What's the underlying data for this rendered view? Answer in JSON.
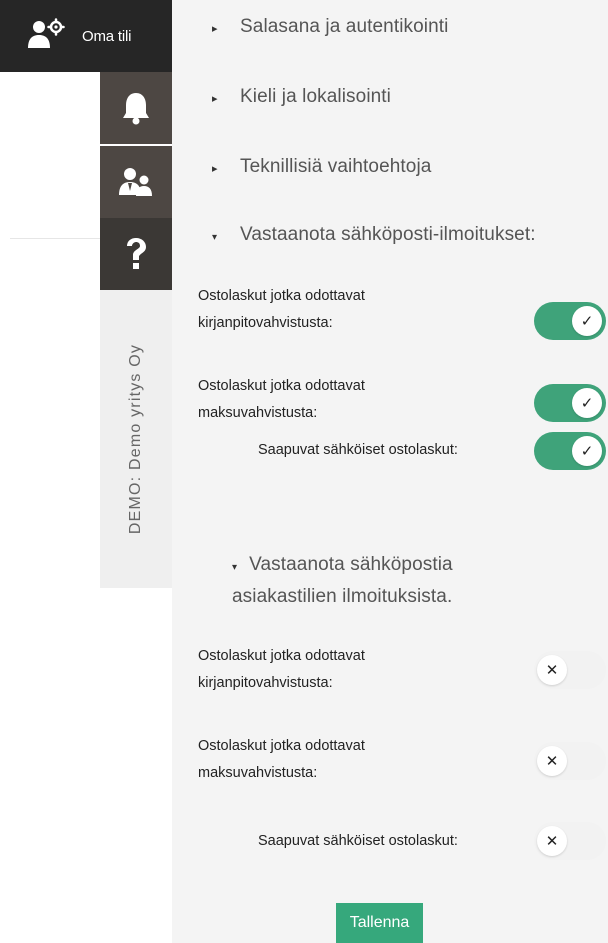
{
  "account": {
    "label": "Oma tili",
    "icon": "user-settings-icon"
  },
  "sidebar": {
    "tabs": [
      {
        "name": "notifications",
        "icon": "bell-icon"
      },
      {
        "name": "users",
        "icon": "users-icon"
      },
      {
        "name": "help",
        "icon": "question-icon"
      }
    ],
    "company_label": "DEMO: Demo yritys Oy"
  },
  "sections": {
    "password": "Salasana ja autentikointi",
    "language": "Kieli ja lokalisointi",
    "technical": "Teknillisiä vaihtoehtoja",
    "email_notifications": "Vastaanota sähköposti-ilmoitukset:",
    "customer_account_emails": "Vastaanota sähköpostia asiakastilien ilmoituksista."
  },
  "email_settings": [
    {
      "line1": "Ostolaskut jotka odottavat",
      "line2": "kirjanpitovahvistusta:",
      "enabled": true
    },
    {
      "line1": "Ostolaskut jotka odottavat",
      "line2": "maksuvahvistusta:",
      "enabled": true
    },
    {
      "label": "Saapuvat sähköiset ostolaskut:",
      "enabled": true
    }
  ],
  "customer_settings": [
    {
      "line1": "Ostolaskut jotka odottavat",
      "line2": "kirjanpitovahvistusta:",
      "enabled": false
    },
    {
      "line1": "Ostolaskut jotka odottavat",
      "line2": "maksuvahvistusta:",
      "enabled": false
    },
    {
      "label": "Saapuvat sähköiset ostolaskut:",
      "enabled": false
    }
  ],
  "toggle_symbols": {
    "on": "✓",
    "off": "✕"
  },
  "save_label": "Tallenna",
  "colors": {
    "accent": "#3fa37a",
    "save": "#36a87c",
    "dark": "#262626",
    "tab": "#4d4743"
  }
}
